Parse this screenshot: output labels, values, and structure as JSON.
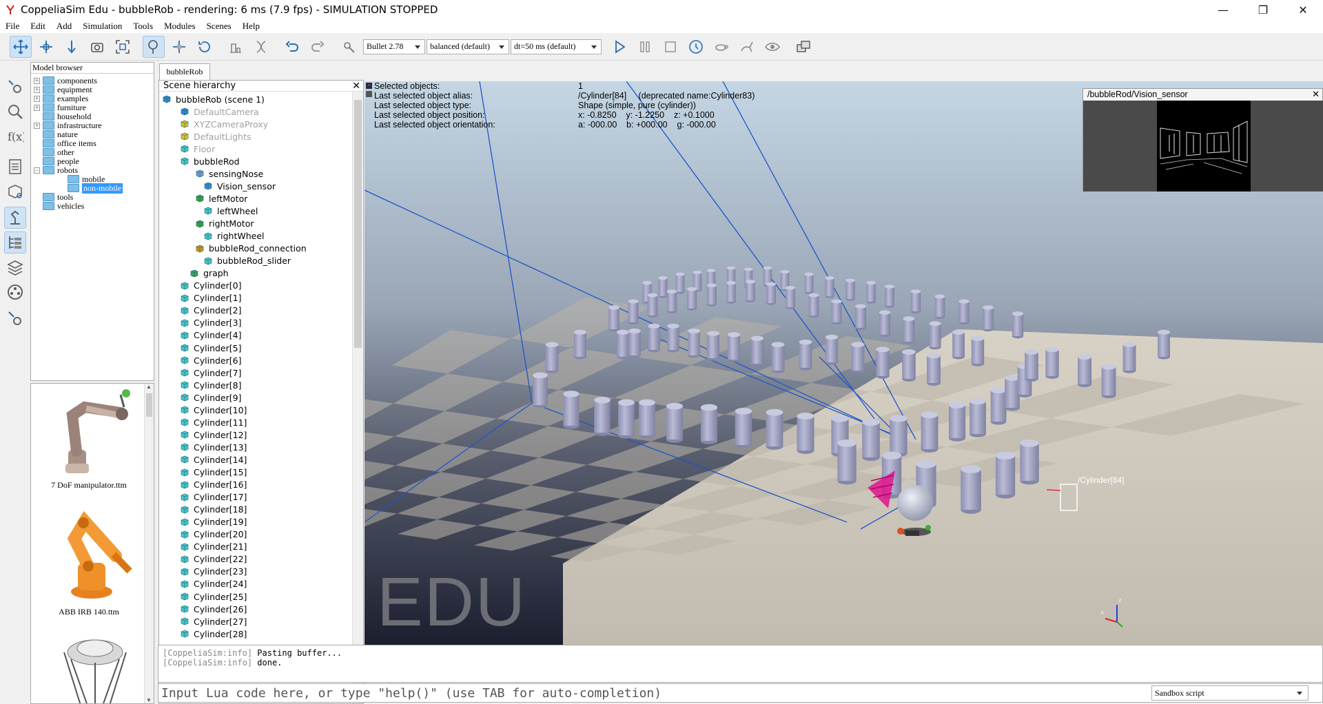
{
  "window": {
    "title": "CoppeliaSim Edu - bubbleRob - rendering: 6 ms (7.9 fps) - SIMULATION STOPPED",
    "minimize": "—",
    "maximize": "❐",
    "close": "✕"
  },
  "menu": [
    "File",
    "Edit",
    "Add",
    "Simulation",
    "Tools",
    "Modules",
    "Scenes",
    "Help"
  ],
  "toolbar": {
    "engine": "Bullet 2.78",
    "accuracy": "balanced (default)",
    "timestep": "dt=50 ms (default)"
  },
  "model_browser": {
    "title": "Model browser",
    "items": [
      {
        "label": "components",
        "expander": "+"
      },
      {
        "label": "equipment",
        "expander": "+"
      },
      {
        "label": "examples",
        "expander": "+"
      },
      {
        "label": "furniture",
        "expander": "+"
      },
      {
        "label": "household",
        "expander": ""
      },
      {
        "label": "infrastructure",
        "expander": "+"
      },
      {
        "label": "nature",
        "expander": ""
      },
      {
        "label": "office items",
        "expander": ""
      },
      {
        "label": "other",
        "expander": ""
      },
      {
        "label": "people",
        "expander": ""
      },
      {
        "label": "robots",
        "expander": "−"
      },
      {
        "label": "mobile",
        "expander": ""
      },
      {
        "label": "non-mobile",
        "expander": ""
      },
      {
        "label": "tools",
        "expander": ""
      },
      {
        "label": "vehicles",
        "expander": ""
      }
    ],
    "thumbnails": [
      {
        "caption": "7 DoF manipulator.ttm"
      },
      {
        "caption": "ABB IRB 140.ttm"
      }
    ]
  },
  "scene_tab": {
    "label": "bubbleRob"
  },
  "hierarchy": {
    "title": "Scene hierarchy",
    "close": "✕",
    "items": [
      {
        "label": "bubbleRob (scene 1)"
      },
      {
        "label": "DefaultCamera"
      },
      {
        "label": "XYZCameraProxy"
      },
      {
        "label": "DefaultLights"
      },
      {
        "label": "Floor"
      },
      {
        "label": "bubbleRod"
      },
      {
        "label": "sensingNose"
      },
      {
        "label": "Vision_sensor"
      },
      {
        "label": "leftMotor"
      },
      {
        "label": "leftWheel"
      },
      {
        "label": "rightMotor"
      },
      {
        "label": "rightWheel"
      },
      {
        "label": "bubbleRod_connection"
      },
      {
        "label": "bubbleRod_slider"
      },
      {
        "label": "graph"
      }
    ],
    "cylinders": [
      "Cylinder[0]",
      "Cylinder[1]",
      "Cylinder[2]",
      "Cylinder[3]",
      "Cylinder[4]",
      "Cylinder[5]",
      "Cylinder[6]",
      "Cylinder[7]",
      "Cylinder[8]",
      "Cylinder[9]",
      "Cylinder[10]",
      "Cylinder[11]",
      "Cylinder[12]",
      "Cylinder[13]",
      "Cylinder[14]",
      "Cylinder[15]",
      "Cylinder[16]",
      "Cylinder[17]",
      "Cylinder[18]",
      "Cylinder[19]",
      "Cylinder[20]",
      "Cylinder[21]",
      "Cylinder[22]",
      "Cylinder[23]",
      "Cylinder[24]",
      "Cylinder[25]",
      "Cylinder[26]",
      "Cylinder[27]",
      "Cylinder[28]"
    ]
  },
  "info": {
    "labels": [
      "Selected objects:",
      "Last selected object alias:",
      "Last selected object type:",
      "Last selected object position:",
      "Last selected object orientation:"
    ],
    "values": [
      "1",
      "/Cylinder[84]     (deprecated name:Cylinder83)",
      "Shape (simple, pure (cylinder))",
      "x: -0.8250    y: -1.2250    z: +0.1000",
      "a: -000.00    b: +000.00    g: -000.00"
    ]
  },
  "viewport": {
    "watermark": "EDU",
    "selected_label": "/Cylinder[84]",
    "axis_x": "x",
    "axis_z": "z"
  },
  "vision_sensor": {
    "title": "/bubbleRod/Vision_sensor",
    "close": "✕"
  },
  "console": {
    "lines": [
      {
        "prefix": "[CoppeliaSim:info]",
        "text": "Pasting buffer..."
      },
      {
        "prefix": "[CoppeliaSim:info]",
        "text": "done."
      }
    ]
  },
  "command": {
    "placeholder": "Input Lua code here, or type \"help()\" (use TAB for auto-completion)",
    "script_type": "Sandbox script"
  }
}
